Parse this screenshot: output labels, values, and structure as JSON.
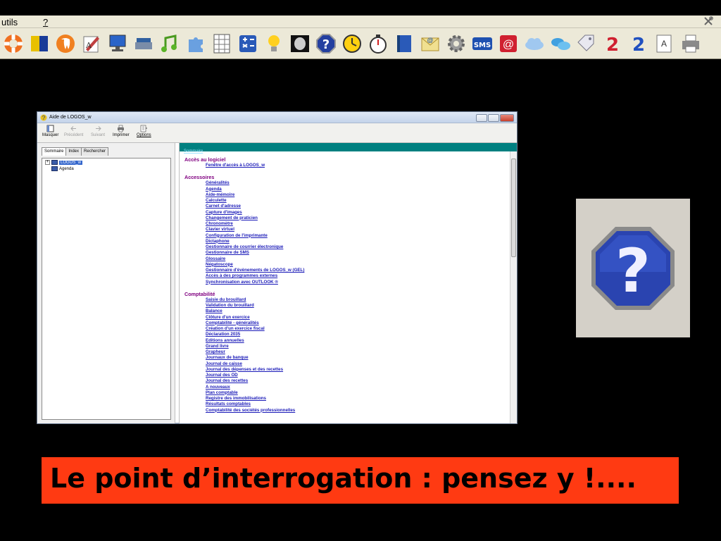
{
  "app": {
    "menu": [
      "utils",
      "?"
    ]
  },
  "toolbar": {
    "icons": [
      "lifebuoy-icon",
      "color-square-icon",
      "tooth-icon",
      "pen-doc-icon",
      "monitor-user-icon",
      "scanner-icon",
      "music-note-icon",
      "puzzle-icon",
      "keyboard-grid-icon",
      "calculator-icon",
      "lightbulb-icon",
      "xray-icon",
      "help-octagon-icon",
      "clock-icon",
      "stopwatch-icon",
      "book-icon",
      "email-icon",
      "gear-icon",
      "sms-icon",
      "mail-at-icon",
      "cloud-icon",
      "chat-bubbles-icon",
      "tag-icon",
      "red-2-icon",
      "blue-2-icon",
      "letter-a-icon",
      "printer-icon"
    ],
    "sms_label": "SMS"
  },
  "help_window": {
    "title": "Aide de LOGOS_w",
    "buttons": [
      {
        "label": "Masquer",
        "icon": "hide-pane-icon",
        "disabled": false
      },
      {
        "label": "Précédent",
        "icon": "back-arrow-icon",
        "disabled": true
      },
      {
        "label": "Suivant",
        "icon": "forward-arrow-icon",
        "disabled": true
      },
      {
        "label": "Imprimer",
        "icon": "printer-icon",
        "disabled": false
      },
      {
        "label": "Options",
        "icon": "options-icon",
        "disabled": false
      }
    ],
    "tabs": [
      "Sommaire",
      "Index",
      "Rechercher"
    ],
    "tree": [
      {
        "label": "LOGOS_w",
        "selected": true,
        "expandable": true
      },
      {
        "label": "Agenda",
        "selected": false,
        "expandable": false
      }
    ],
    "content_header": "Sommaire",
    "sections": [
      {
        "title": "Accès au logiciel",
        "links": [
          "Fenêtre d'accès à LOGOS_w"
        ]
      },
      {
        "title": "Accessoires",
        "links": [
          "Généralités",
          "Agenda",
          "Aide-mémoire",
          "Calculette",
          "Carnet d'adresse",
          "Capture d'images",
          "Changement de praticien",
          "Chronomètre",
          "Clavier virtuel",
          "Configuration de l'imprimante",
          "Dictaphone",
          "Gestionnaire de courrier électronique",
          "Gestionnaire de SMS",
          "Glossaire",
          "Négatoscope",
          "Gestionnaire d'évènements de LOGOS_w (GEL)",
          "Accès à des programmes externes",
          "Synchronisation avec OUTLOOK ®"
        ]
      },
      {
        "title": "Comptabilité",
        "links": [
          "Saisie du brouillard",
          "Validation du brouillard",
          "Balance",
          "Clôture d'un exercice",
          "Comptabilité - généralités",
          "Création d'un exercice fiscal",
          "Déclaration 2035",
          "Editions annuelles",
          "Grand livre",
          "Grapheur",
          "Journaux de banque",
          "Journal de caisse",
          "Journal des dépenses et des recettes",
          "Journal des OD",
          "Journal des recettes",
          "A nouveaux",
          "Plan comptable",
          "Registre des immobilisations",
          "Résultats comptables",
          "Comptabilité des sociétés professionnelles"
        ]
      }
    ]
  },
  "caption": "Le point d’interrogation : pensez y !...."
}
